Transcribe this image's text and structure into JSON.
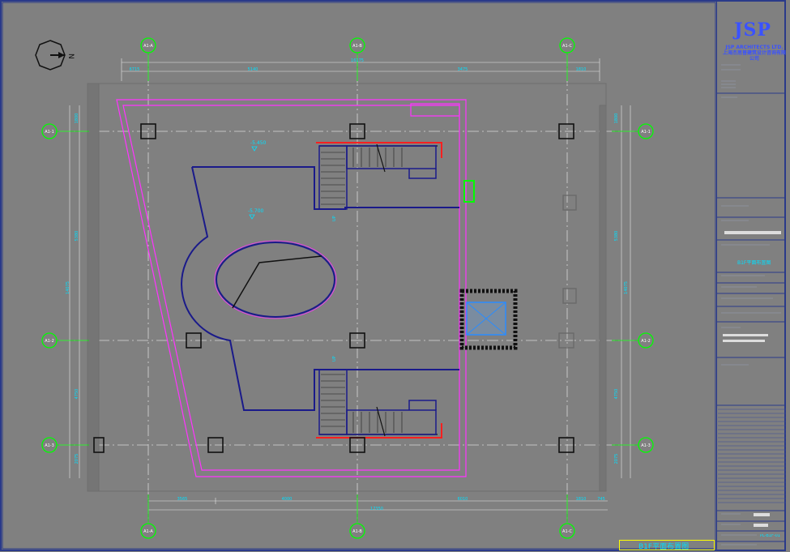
{
  "drawing": {
    "north_label": "N",
    "axes": {
      "top": [
        "A1-A",
        "A1-B",
        "A1-C"
      ],
      "bottom": [
        "A1-A",
        "A1-B",
        "A1-C"
      ],
      "left": [
        "A1-1",
        "A1-2",
        "A1-3"
      ],
      "right": [
        "A1-1",
        "A1-2",
        "A1-3"
      ]
    },
    "dimensions": {
      "top_total": "16175",
      "top_segments": [
        "6715",
        "5140",
        "3475",
        "1810"
      ],
      "bottom_total": "17350",
      "bottom_segments": [
        "3565",
        "4000",
        "6010",
        "1810",
        "745"
      ],
      "left_total": "14075",
      "left_segments": [
        "1800",
        "5380",
        "4750",
        "2075"
      ],
      "right_total": "14075",
      "right_segments": [
        "1800",
        "5380",
        "4750",
        "2075"
      ]
    },
    "levels": [
      "-5.450",
      "-5.700"
    ],
    "stair_labels": [
      "UP",
      "UP"
    ],
    "caption": "B1F平面布置图"
  },
  "title_block": {
    "logo": "JSP",
    "company_en": "JSP ARCHITECTS LTD.",
    "company_cn": "上海杰思普建筑设计咨询有限公司",
    "drawing_name": "B1F平面布置图",
    "drawing_no": "PL-B1F-01"
  },
  "colors": {
    "line": "#1a1a1a",
    "magenta": "#ff33ff",
    "navy": "#1a1a8a",
    "cyan": "#00e0ff",
    "green": "#00ff00",
    "red": "#ff2020",
    "yellow": "#ffff00",
    "border": "#2a3a8a"
  }
}
